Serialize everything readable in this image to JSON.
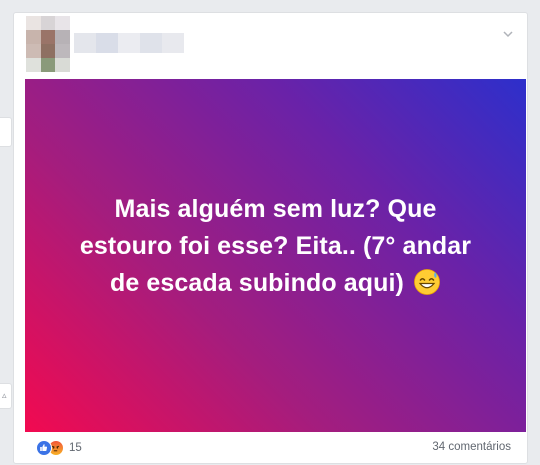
{
  "post": {
    "message": "Mais alguém sem luz? Que estouro foi esse? Eita.. (7° andar de escada subindo aqui)",
    "emoji_icon": "grinning-sweat-emoji",
    "background_colors": [
      "#2d2fcb",
      "#6a22a8",
      "#a41d7e",
      "#f20a50"
    ]
  },
  "footer": {
    "reaction_icons": [
      "like-icon",
      "angry-icon"
    ],
    "reaction_count": "15",
    "comments_label": "34 comentários"
  },
  "header": {
    "options_icon": "chevron-down-icon"
  }
}
